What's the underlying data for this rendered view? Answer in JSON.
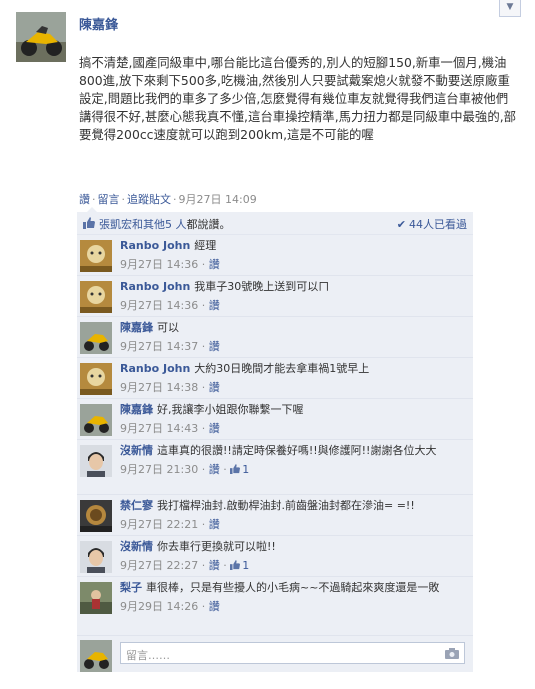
{
  "post": {
    "author": "陳嘉鋒",
    "text": "搞不清楚,國產同級車中,哪台能比這台優秀的,別人的短腳150,新車一個月,機油800進,放下來剩下500多,吃機油,然後別人只要試戴案熄火就發不動要送原廠重設定,問題比我們的車多了多少倍,怎麼覺得有幾位車友就覺得我們這台車被他們講得很不好,甚麼心態我真不懂,這台車操控精準,馬力扭力都是同級車中最強的,部要覺得200cc速度就可以跑到200km,這是不可能的喔",
    "actions": {
      "like": "讚",
      "comment": "留言",
      "follow": "追蹤貼文",
      "time": "9月27日 14:09"
    }
  },
  "likes": {
    "names": "張凱宏和其他",
    "count": "5 人",
    "suffix": "都說讚。",
    "seen": "44人已看過"
  },
  "comments": [
    {
      "name": "Ranbo John",
      "text": "經理",
      "time": "9月27日 14:36",
      "like": "讚",
      "likes": ""
    },
    {
      "name": "Ranbo John",
      "text": "我車子30號晚上送到可以ㄇ",
      "time": "9月27日 14:36",
      "like": "讚",
      "likes": ""
    },
    {
      "name": "陳嘉鋒",
      "text": "可以",
      "time": "9月27日 14:37",
      "like": "讚",
      "likes": ""
    },
    {
      "name": "Ranbo John",
      "text": "大約30日晚間才能去拿車禍1號早上",
      "time": "9月27日 14:38",
      "like": "讚",
      "likes": ""
    },
    {
      "name": "陳嘉鋒",
      "text": "好,我讓李小姐跟你聯繫一下喔",
      "time": "9月27日 14:43",
      "like": "讚",
      "likes": ""
    },
    {
      "name": "沒新情",
      "text": "這車真的很讚!!請定時保養好嗎!!與修護阿!!謝謝各位大大",
      "time": "9月27日 21:30",
      "like": "讚",
      "likes": "1"
    },
    {
      "name": "禁仁寥",
      "text": "我打檔桿油封.啟動桿油封.前齒盤油封都在滲油= =!!",
      "time": "9月27日 22:21",
      "like": "讚",
      "likes": ""
    },
    {
      "name": "沒新情",
      "text": "你去車行更換就可以啦!!",
      "time": "9月27日 22:27",
      "like": "讚",
      "likes": "1"
    },
    {
      "name": "梨子",
      "text": "車很棒，只是有些擾人的小毛病~~不過騎起來爽度還是一敗",
      "time": "9月29日 14:26",
      "like": "讚",
      "likes": ""
    }
  ],
  "reply": {
    "placeholder": "留言……"
  }
}
